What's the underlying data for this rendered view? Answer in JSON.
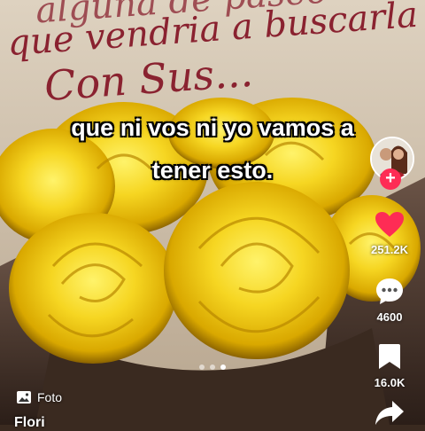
{
  "background_text": {
    "line1": "alguna de paseo",
    "line2": "que vendria a buscarla",
    "line3": "Con Sus..."
  },
  "caption": {
    "line1": "que ni vos ni yo vamos a",
    "line2": "tener esto."
  },
  "actions": {
    "likes": "251.2K",
    "comments": "4600",
    "saves": "16.0K"
  },
  "carousel": {
    "count": 3,
    "active_index": 2
  },
  "media_type_label": "Foto",
  "author_name": "Flori",
  "icons": {
    "avatar": "avatar-icon",
    "follow": "plus-icon",
    "like": "heart-icon",
    "comment": "comment-icon",
    "save": "bookmark-icon",
    "share": "share-icon",
    "photo": "photo-icon"
  },
  "colors": {
    "like_active": "#fe2c55",
    "rose": "#f2cf1e",
    "handwriting": "#8a2230"
  }
}
